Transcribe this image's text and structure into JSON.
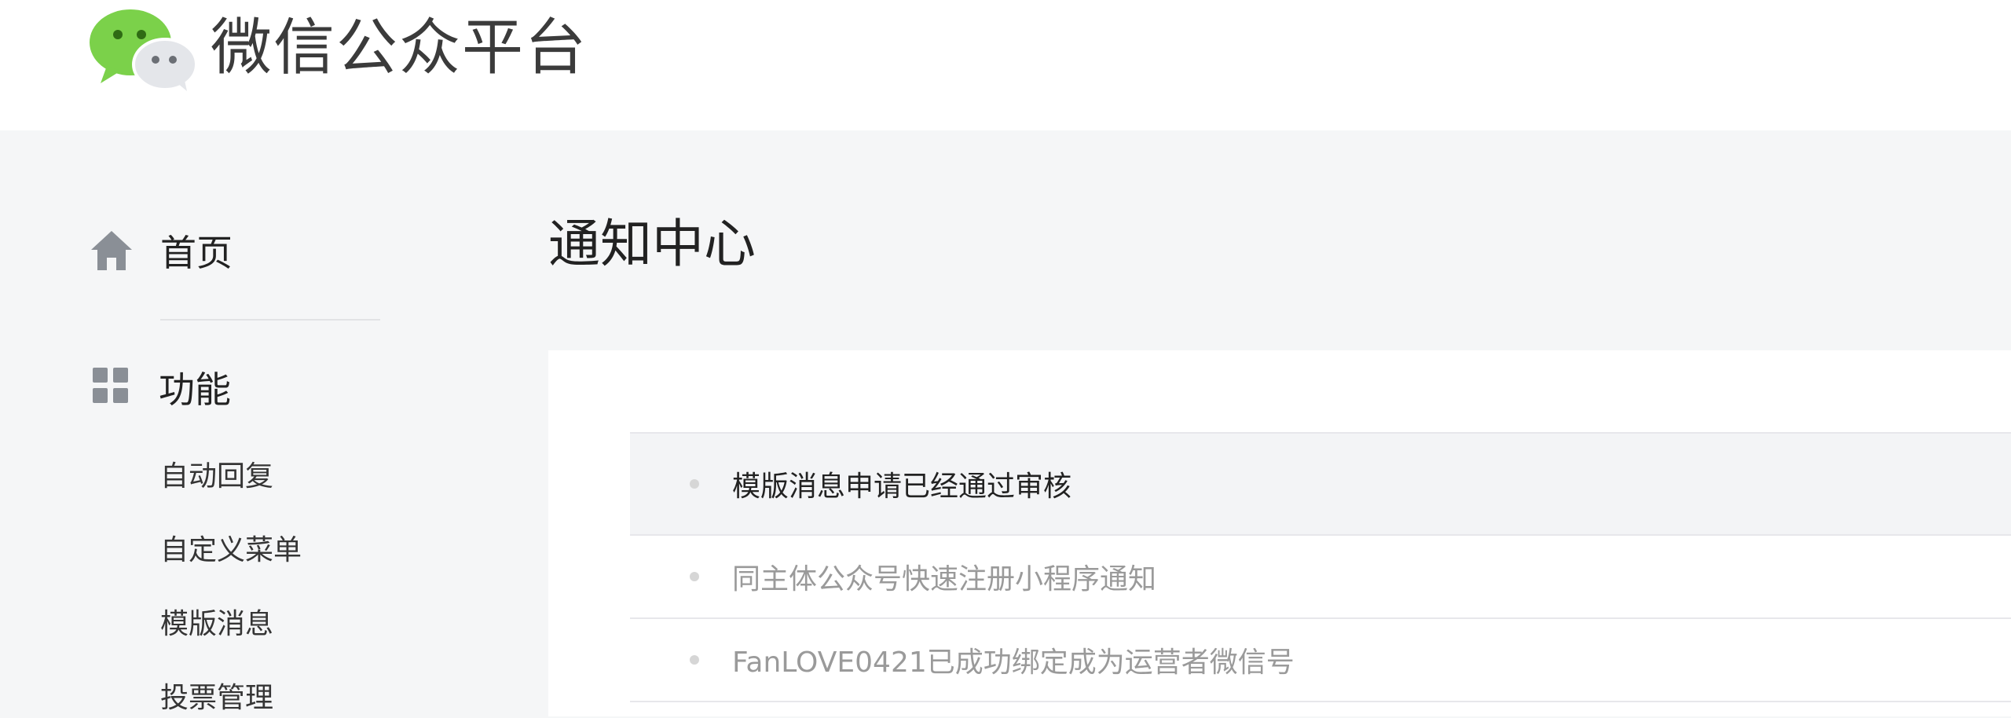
{
  "header": {
    "brand_title": "微信公众平台"
  },
  "sidebar": {
    "home_label": "首页",
    "features_label": "功能",
    "sub_items": [
      {
        "label": "自动回复"
      },
      {
        "label": "自定义菜单"
      },
      {
        "label": "模版消息"
      },
      {
        "label": "投票管理"
      }
    ]
  },
  "main": {
    "page_title": "通知中心",
    "notifications": [
      {
        "text": "模版消息申请已经通过审核"
      },
      {
        "text": "同主体公众号快速注册小程序通知"
      },
      {
        "text": "FanLOVE0421已成功绑定成为运营者微信号"
      }
    ]
  },
  "icons": {
    "logo": "wechat-logo-icon",
    "home": "home-icon",
    "features": "grid-icon"
  },
  "colors": {
    "logo_green": "#7bd14a",
    "logo_grey": "#e4e6ea",
    "page_bg": "#f5f6f7",
    "icon_grey": "#8a8f96"
  }
}
